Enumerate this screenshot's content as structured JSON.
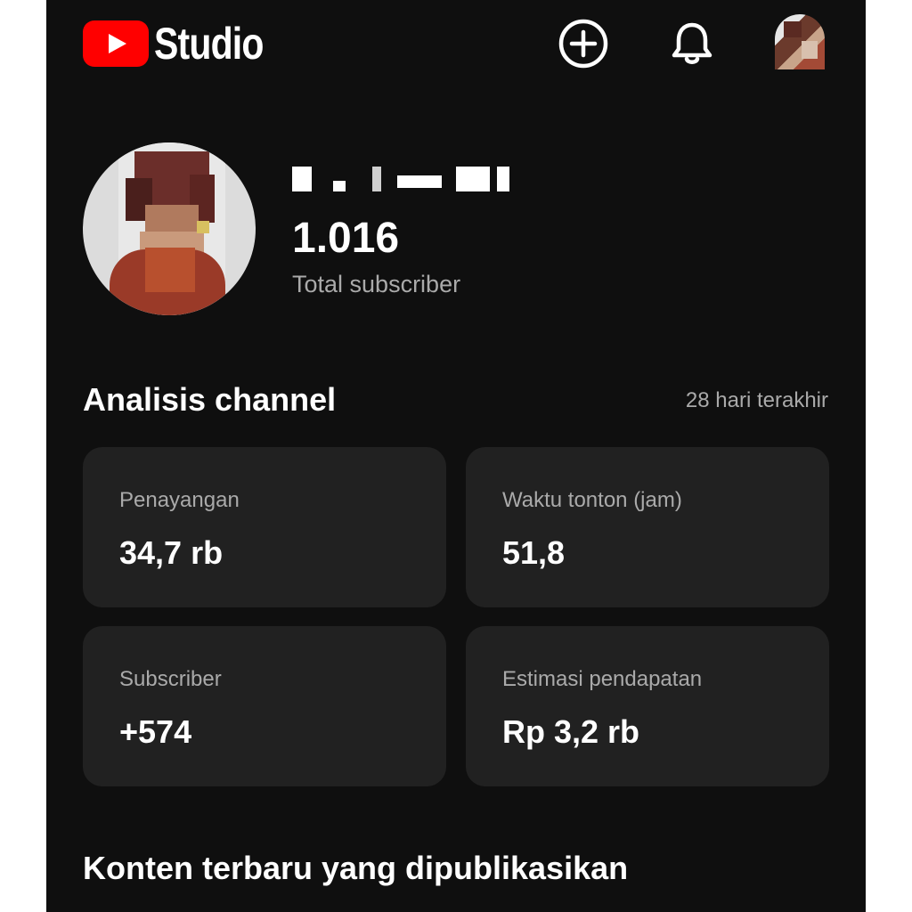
{
  "header": {
    "logo_text": "Studio",
    "brand_color": "#ff0000",
    "icons": [
      "create-icon",
      "bell-icon"
    ]
  },
  "channel": {
    "subscriber_count": "1.016",
    "subscriber_label": "Total subscriber"
  },
  "analytics": {
    "title": "Analisis channel",
    "period": "28 hari terakhir",
    "cards": [
      {
        "label": "Penayangan",
        "value": "34,7 rb"
      },
      {
        "label": "Waktu tonton (jam)",
        "value": "51,8"
      },
      {
        "label": "Subscriber",
        "value": "+574"
      },
      {
        "label": "Estimasi pendapatan",
        "value": "Rp 3,2 rb"
      }
    ]
  },
  "recent": {
    "title": "Konten terbaru yang dipublikasikan"
  }
}
